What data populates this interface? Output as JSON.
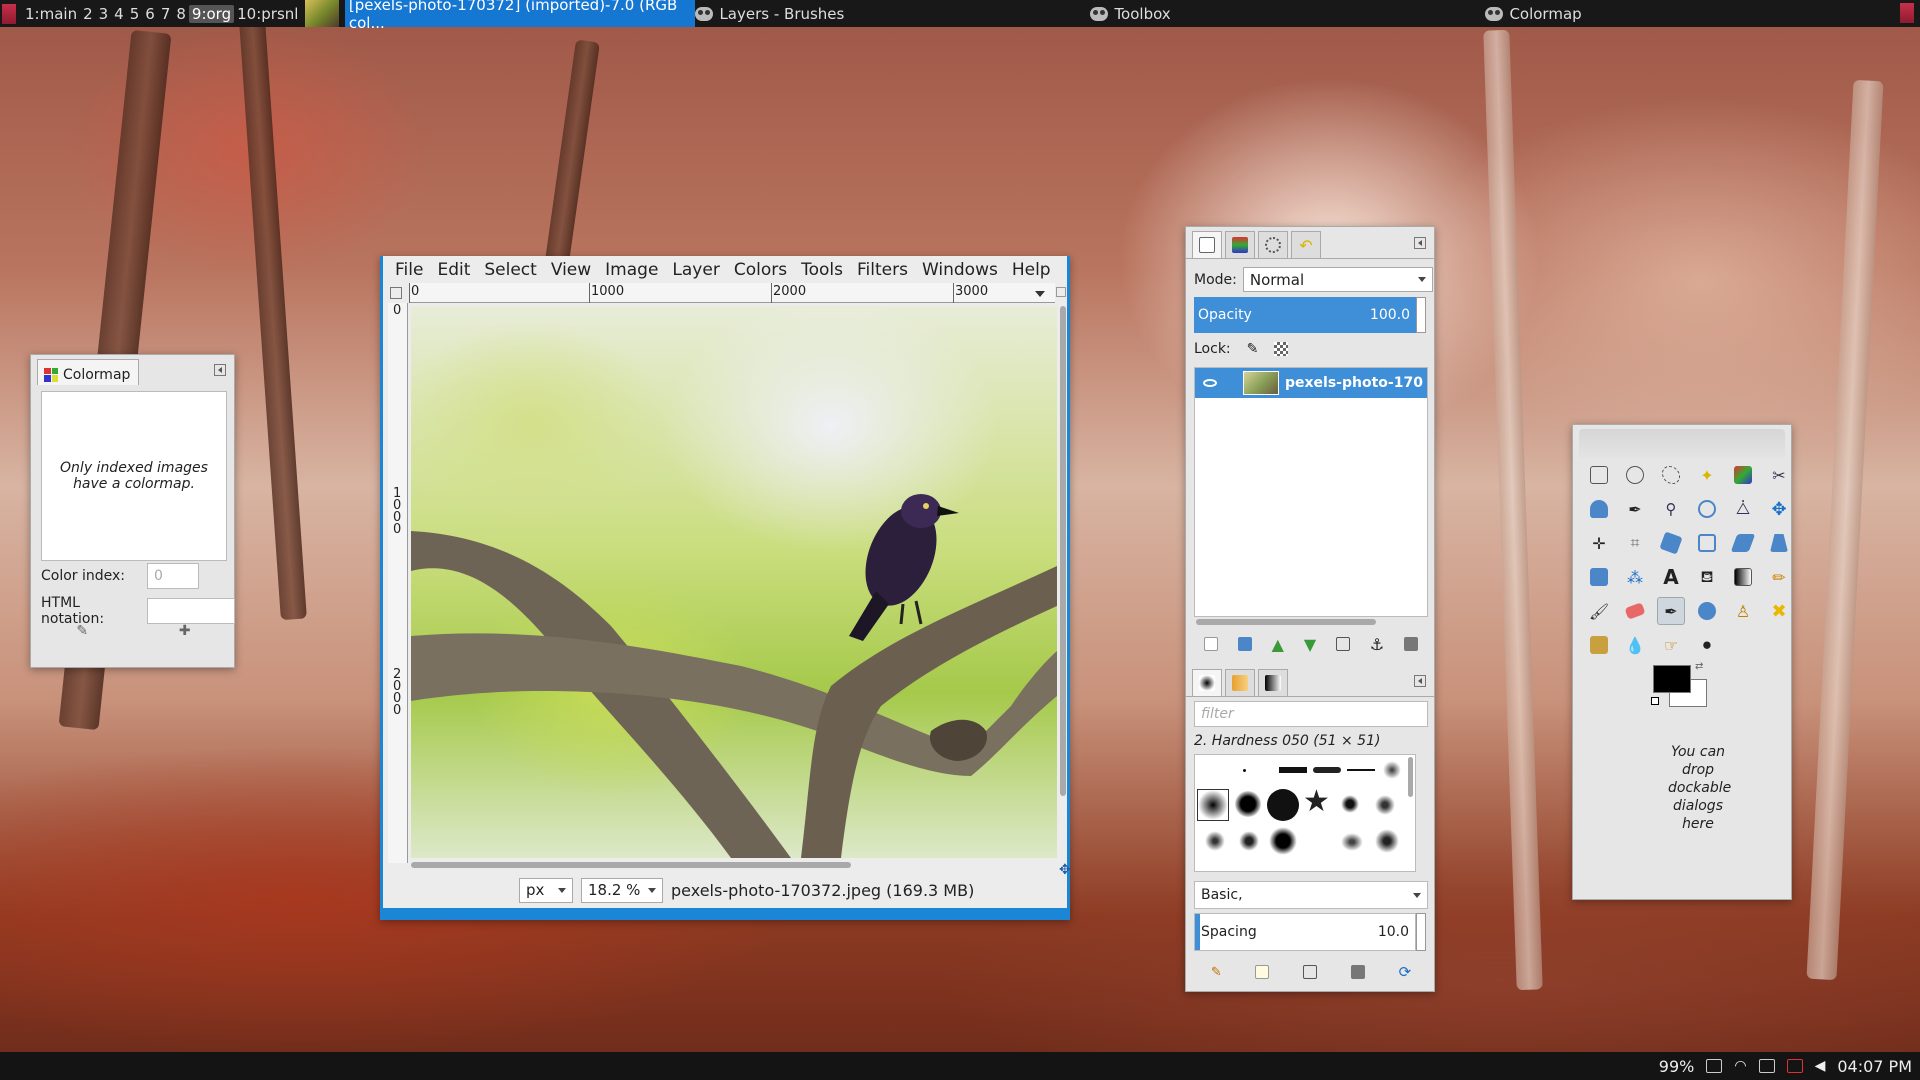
{
  "topbar": {
    "workspaces": [
      "1:main",
      "2",
      "3",
      "4",
      "5",
      "6",
      "7",
      "8",
      "9:org",
      "10:prsnl"
    ],
    "active_workspace": "9:org",
    "tasks": [
      {
        "title": "[pexels-photo-170372] (imported)-7.0 (RGB col...",
        "active": true
      },
      {
        "title": "Layers - Brushes",
        "active": false
      },
      {
        "title": "Toolbox",
        "active": false
      },
      {
        "title": "Colormap",
        "active": false
      }
    ]
  },
  "bottombar": {
    "battery": "99%",
    "clock": "04:07 PM"
  },
  "colormap": {
    "tab_label": "Colormap",
    "message": "Only indexed images have a colormap.",
    "color_index_label": "Color index:",
    "color_index_value": "0",
    "html_notation_label": "HTML notation:",
    "html_notation_value": ""
  },
  "image_window": {
    "menu": [
      "File",
      "Edit",
      "Select",
      "View",
      "Image",
      "Layer",
      "Colors",
      "Tools",
      "Filters",
      "Windows",
      "Help"
    ],
    "hruler_labels": [
      "0",
      "1000",
      "2000",
      "3000"
    ],
    "vruler_labels": [
      "0",
      "1000",
      "2000"
    ],
    "unit": "px",
    "zoom": "18.2 %",
    "status": "pexels-photo-170372.jpeg (169.3 MB)"
  },
  "layers": {
    "mode_label": "Mode:",
    "mode_value": "Normal",
    "opacity_label": "Opacity",
    "opacity_value": "100.0",
    "lock_label": "Lock:",
    "layer_name": "pexels-photo-170",
    "filter_placeholder": "filter",
    "brush_name": "2. Hardness 050 (51 × 51)",
    "brush_set": "Basic,",
    "spacing_label": "Spacing",
    "spacing_value": "10.0"
  },
  "toolbox": {
    "drop_hint": "You can drop dockable dialogs here",
    "fg_color": "#000000",
    "bg_color": "#ffffff"
  }
}
